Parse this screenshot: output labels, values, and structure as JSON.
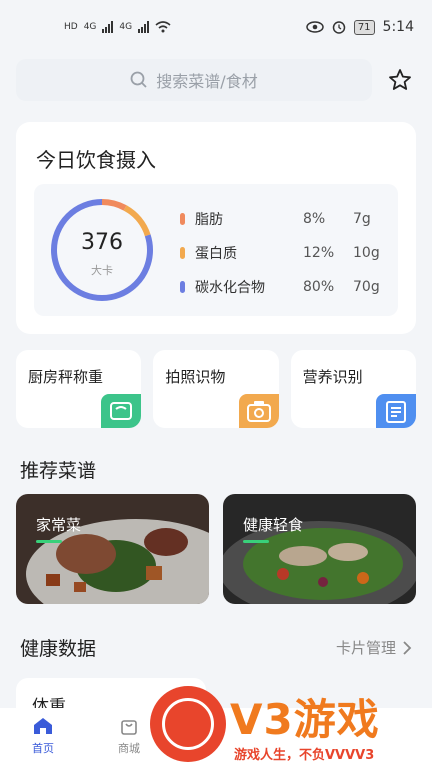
{
  "status_bar": {
    "left_tags": [
      "HD",
      "4G",
      "4G"
    ],
    "time": "5:14",
    "battery": "71"
  },
  "search": {
    "placeholder": "搜索菜谱/食材"
  },
  "intake": {
    "title": "今日饮食摄入",
    "kcal": "376",
    "kcal_unit": "大卡",
    "nutrients": [
      {
        "name": "脂肪",
        "percent": "8%",
        "amount": "7g",
        "color": "#f08a5d"
      },
      {
        "name": "蛋白质",
        "percent": "12%",
        "amount": "10g",
        "color": "#f2a94e"
      },
      {
        "name": "碳水化合物",
        "percent": "80%",
        "amount": "70g",
        "color": "#6c7ee1"
      }
    ],
    "ring": {
      "fat": 0.08,
      "protein": 0.12,
      "carbs": 0.8
    }
  },
  "tools": [
    {
      "label": "厨房秤称重",
      "icon": "scale-icon",
      "color": "#3cc48a"
    },
    {
      "label": "拍照识物",
      "icon": "camera-icon",
      "color": "#f2a94e"
    },
    {
      "label": "营养识别",
      "icon": "document-icon",
      "color": "#4f8ff0"
    }
  ],
  "recommend": {
    "title": "推荐菜谱",
    "items": [
      {
        "label": "家常菜"
      },
      {
        "label": "健康轻食"
      }
    ]
  },
  "health": {
    "title": "健康数据",
    "manage": "卡片管理",
    "weight_label": "体重"
  },
  "nav": {
    "items": [
      {
        "label": "首页",
        "icon": "home-icon",
        "active": true
      },
      {
        "label": "商城",
        "icon": "shop-bag-icon",
        "active": false
      }
    ]
  },
  "watermark": {
    "big": "V3游戏",
    "sub": "游戏人生，不负VVVV3"
  },
  "colors": {
    "accent": "#3a5bd9",
    "recipe_underline": "#39d07a"
  }
}
